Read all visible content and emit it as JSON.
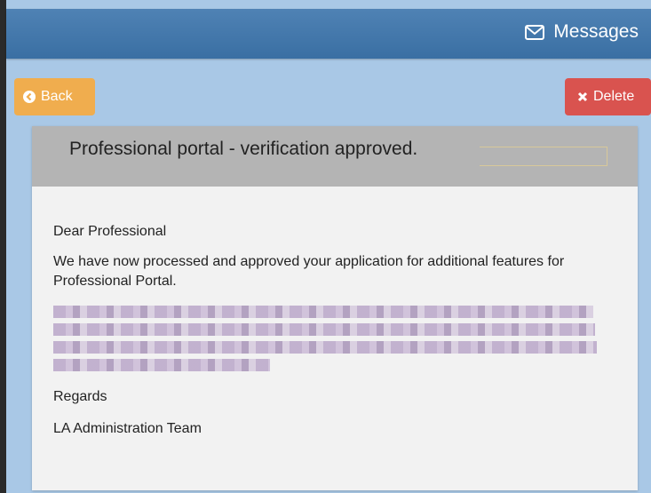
{
  "header": {
    "messages_label": "Messages",
    "icon": "envelope-icon"
  },
  "toolbar": {
    "back_label": "Back",
    "back_icon": "arrow-left-circle-icon",
    "delete_label": "Delete",
    "delete_icon": "close-icon"
  },
  "message": {
    "title": "Professional portal - verification approved.",
    "greeting": "Dear Professional",
    "body": "We have now processed and approved your application for additional features for Professional Portal.",
    "regards": "Regards",
    "signature": "LA Administration Team"
  },
  "colors": {
    "header": "#3f74a8",
    "background": "#a9c8e6",
    "back_button": "#f0ad4e",
    "delete_button": "#d9534f",
    "panel_header": "#b4b4b4"
  }
}
